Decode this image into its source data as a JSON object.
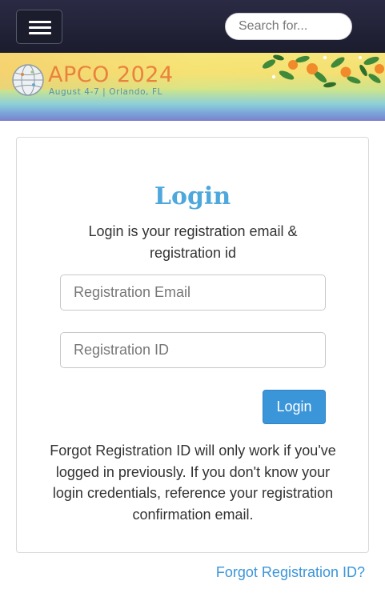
{
  "header": {
    "menu_icon": "hamburger-menu-icon",
    "search_placeholder": "Search for..."
  },
  "banner": {
    "logo_icon": "globe-icon",
    "title": "APCO 2024",
    "subtitle": "August 4-7 | Orlando, FL",
    "colors": {
      "title": "#e9823d",
      "subtitle": "#5d8fa8"
    }
  },
  "login_card": {
    "title": "Login",
    "subtitle": "Login is your registration email & registration id",
    "email_placeholder": "Registration Email",
    "id_placeholder": "Registration ID",
    "login_button": "Login",
    "note": "Forgot Registration ID will only work if you've logged in previously. If you don't know your login credentials, reference your registration confirmation email.",
    "colors": {
      "title": "#4fa8dc",
      "button": "#3a95d9"
    }
  },
  "forgot_link": "Forgot Registration ID?"
}
